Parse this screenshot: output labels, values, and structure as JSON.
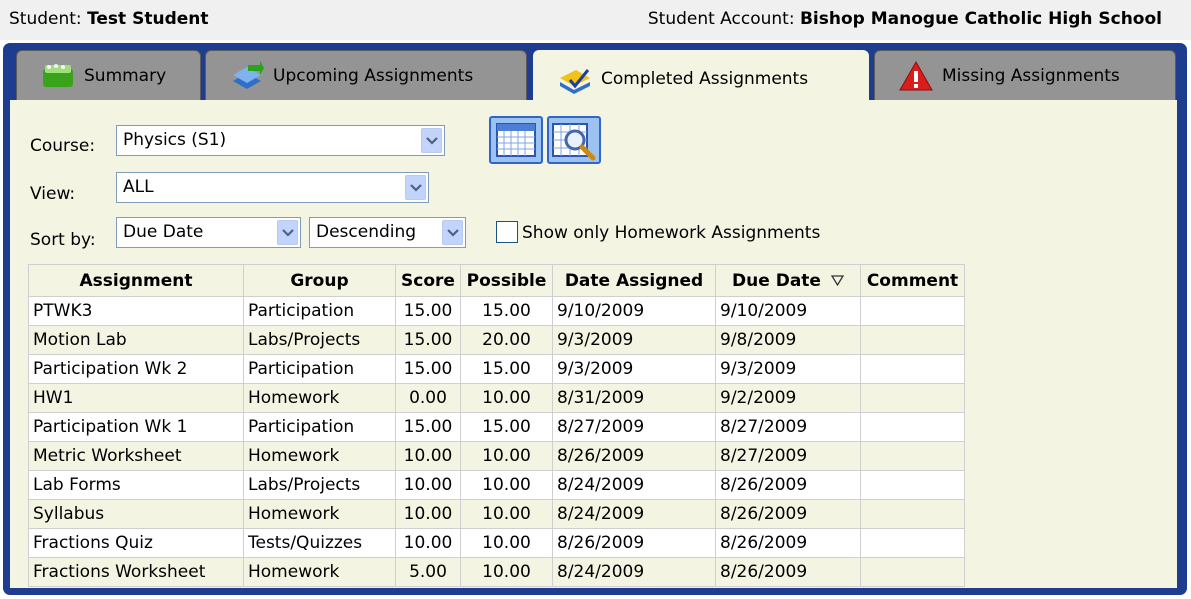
{
  "header": {
    "student_label": "Student:",
    "student_name": "Test Student",
    "account_label": "Student Account:",
    "account_name": "Bishop Manogue Catholic High School"
  },
  "tabs": [
    {
      "label": "Summary",
      "icon": "summary-icon",
      "active": false
    },
    {
      "label": "Upcoming Assignments",
      "icon": "upcoming-icon",
      "active": false
    },
    {
      "label": "Completed Assignments",
      "icon": "completed-icon",
      "active": true
    },
    {
      "label": "Missing Assignments",
      "icon": "warning-icon",
      "active": false
    }
  ],
  "filters": {
    "course_label": "Course:",
    "course_value": "Physics (S1)",
    "view_label": "View:",
    "view_value": "ALL",
    "sort_label": "Sort by:",
    "sort_field": "Due Date",
    "sort_order": "Descending",
    "homework_only_label": "Show only Homework Assignments",
    "homework_only_checked": false
  },
  "table": {
    "columns": [
      "Assignment",
      "Group",
      "Score",
      "Possible",
      "Date Assigned",
      "Due Date",
      "Comment"
    ],
    "sorted_column": "Due Date",
    "rows": [
      [
        "PTWK3",
        "Participation",
        "15.00",
        "15.00",
        "9/10/2009",
        "9/10/2009",
        ""
      ],
      [
        "Motion Lab",
        "Labs/Projects",
        "15.00",
        "20.00",
        "9/3/2009",
        "9/8/2009",
        ""
      ],
      [
        "Participation Wk 2",
        "Participation",
        "15.00",
        "15.00",
        "9/3/2009",
        "9/3/2009",
        ""
      ],
      [
        "HW1",
        "Homework",
        "0.00",
        "10.00",
        "8/31/2009",
        "9/2/2009",
        ""
      ],
      [
        "Participation Wk 1",
        "Participation",
        "15.00",
        "15.00",
        "8/27/2009",
        "8/27/2009",
        ""
      ],
      [
        "Metric Worksheet",
        "Homework",
        "10.00",
        "10.00",
        "8/26/2009",
        "8/27/2009",
        ""
      ],
      [
        "Lab Forms",
        "Labs/Projects",
        "10.00",
        "10.00",
        "8/24/2009",
        "8/26/2009",
        ""
      ],
      [
        "Syllabus",
        "Homework",
        "10.00",
        "10.00",
        "8/24/2009",
        "8/26/2009",
        ""
      ],
      [
        "Fractions Quiz",
        "Tests/Quizzes",
        "10.00",
        "10.00",
        "8/26/2009",
        "8/26/2009",
        ""
      ],
      [
        "Fractions Worksheet",
        "Homework",
        "5.00",
        "10.00",
        "8/24/2009",
        "8/26/2009",
        ""
      ]
    ]
  },
  "colors": {
    "frame": "#1f3d8f",
    "panel": "#f4f4e3",
    "inactive_tab": "#949494"
  }
}
